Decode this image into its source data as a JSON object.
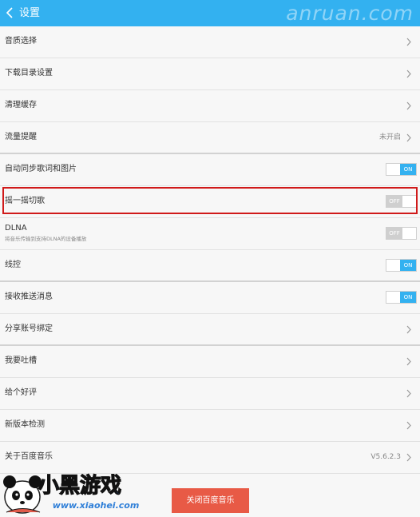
{
  "header": {
    "title": "设置",
    "watermark": "anruan.com"
  },
  "rows": [
    {
      "label": "音质选择"
    },
    {
      "label": "下载目录设置"
    },
    {
      "label": "清理缓存"
    },
    {
      "label": "流量提醒",
      "value": "未开启"
    },
    {
      "label": "自动同步歌词和图片",
      "toggle": "ON"
    },
    {
      "label": "摇一摇切歌",
      "toggle": "OFF"
    },
    {
      "label": "DLNA",
      "sublabel": "将音乐传输到支持DLNA的设备播放",
      "toggle": "OFF"
    },
    {
      "label": "线控",
      "toggle": "ON"
    },
    {
      "label": "接收推送消息",
      "toggle": "ON"
    },
    {
      "label": "分享账号绑定"
    },
    {
      "label": "我要吐槽"
    },
    {
      "label": "给个好评"
    },
    {
      "label": "新版本检测"
    },
    {
      "label": "关于百度音乐",
      "value": "V5.6.2.3"
    }
  ],
  "footer": {
    "logout_label": "关闭百度音乐"
  },
  "logo": {
    "text": "小黑游戏",
    "url_text": "www.xiaohei.com"
  },
  "colors": {
    "accent": "#33b1f0",
    "button": "#e85a46",
    "highlight": "#d01a1a"
  }
}
